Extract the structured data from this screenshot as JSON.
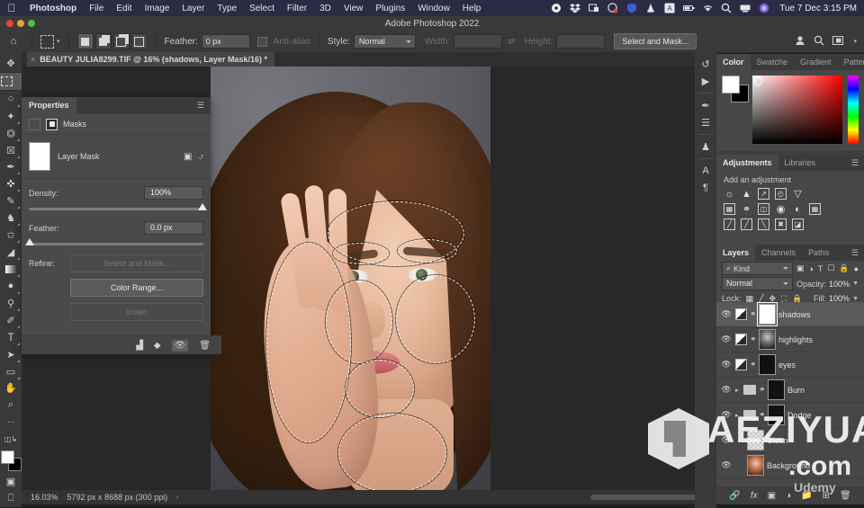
{
  "macmenu": {
    "apple": "apple-logo",
    "items": [
      "Photoshop",
      "File",
      "Edit",
      "Image",
      "Layer",
      "Type",
      "Select",
      "Filter",
      "3D",
      "View",
      "Plugins",
      "Window",
      "Help"
    ],
    "status_icons": [
      "record-icon",
      "dropbox-icon",
      "screenlock-icon",
      "camera-icon",
      "shield-icon",
      "vlc-icon",
      "character-a-icon",
      "battery-icon",
      "wifi-icon",
      "search-icon",
      "display-icon",
      "siri-icon"
    ],
    "clock": "Tue 7 Dec  3:15 PM"
  },
  "window": {
    "title": "Adobe Photoshop 2022"
  },
  "options": {
    "home_icon": "home-icon",
    "tool_icon": "rectangular-marquee-icon",
    "tool_caret": "▾",
    "selection_modes": [
      "new-selection",
      "add-to-selection",
      "subtract-from-selection",
      "intersect-selection"
    ],
    "feather_label": "Feather:",
    "feather_value": "0 px",
    "antialias_label": "Anti-alias",
    "style_label": "Style:",
    "style_value": "Normal",
    "width_label": "Width:",
    "width_value": "",
    "swap_icon": "swap-dimensions-icon",
    "height_label": "Height:",
    "height_value": "",
    "select_and_mask": "Select and Mask...",
    "right_icons": [
      "workspace-user-icon",
      "search-icon",
      "arrange-documents-icon"
    ],
    "right_caret": "▾"
  },
  "tab": {
    "close": "×",
    "title": "BEAUTY JULIA8299.TIF @ 16% (shadows, Layer Mask/16) *"
  },
  "toolbar": {
    "tools": [
      {
        "name": "move-tool",
        "glyph": "✥"
      },
      {
        "name": "rectangular-marquee-tool",
        "glyph": "⬚"
      },
      {
        "name": "lasso-tool",
        "glyph": "⟳"
      },
      {
        "name": "object-selection-tool",
        "glyph": "❦"
      },
      {
        "name": "crop-tool",
        "glyph": "⚔"
      },
      {
        "name": "frame-tool",
        "glyph": "⌧"
      },
      {
        "name": "eyedropper-tool",
        "glyph": "✐"
      },
      {
        "name": "spot-healing-brush-tool",
        "glyph": "✒"
      },
      {
        "name": "brush-tool",
        "glyph": "✎"
      },
      {
        "name": "clone-stamp-tool",
        "glyph": "♟"
      },
      {
        "name": "history-brush-tool",
        "glyph": "☙"
      },
      {
        "name": "eraser-tool",
        "glyph": "◢"
      },
      {
        "name": "gradient-tool",
        "glyph": "▣"
      },
      {
        "name": "blur-tool",
        "glyph": "●"
      },
      {
        "name": "dodge-tool",
        "glyph": "⚲"
      },
      {
        "name": "pen-tool",
        "glyph": "✒"
      },
      {
        "name": "type-tool",
        "glyph": "T"
      },
      {
        "name": "path-selection-tool",
        "glyph": "➤"
      },
      {
        "name": "rectangle-tool",
        "glyph": "▭"
      },
      {
        "name": "hand-tool",
        "glyph": "✋"
      },
      {
        "name": "zoom-tool",
        "glyph": "⌕"
      },
      {
        "name": "edit-toolbar-tool",
        "glyph": "•••"
      },
      {
        "name": "default-colors-tool",
        "glyph": "◧"
      }
    ],
    "foreground_color": "#ffffff",
    "background_color": "#000000",
    "quickmask_icon": "quick-mask-icon",
    "screenmode_icon": "screen-mode-icon"
  },
  "vdock": {
    "icons": [
      "history-icon",
      "actions-play-icon",
      "brush-settings-icon",
      "properties-sliders-icon",
      "clone-source-icon",
      "character-icon",
      "paragraph-icon"
    ]
  },
  "properties": {
    "tab": "Properties",
    "menu_icon": "panel-menu-icon",
    "masks_tabs": [
      "pixel-mask-icon",
      "vector-mask-icon"
    ],
    "masks_label": "Masks",
    "layer_mask_label": "Layer Mask",
    "mask_icons": [
      "select-mask-icon",
      "mask-options-icon"
    ],
    "density_label": "Density:",
    "density_value": "100%",
    "density_percent": 100,
    "feather_label": "Feather:",
    "feather_value": "0.0 px",
    "feather_percent": 0,
    "refine_label": "Refine:",
    "buttons": [
      {
        "label": "Select and Mask...",
        "enabled": false
      },
      {
        "label": "Color Range...",
        "enabled": true
      },
      {
        "label": "Invert",
        "enabled": false
      }
    ],
    "footer_icons": [
      "load-selection-icon",
      "apply-mask-icon",
      "toggle-mask-icon",
      "delete-mask-icon"
    ]
  },
  "canvas": {
    "background": "#282828",
    "zoom": "16.03%",
    "dimensions": "5792 px x 8688 px (300 ppi)",
    "caret": "›"
  },
  "color_panel": {
    "tabs": [
      "Color",
      "Swatche",
      "Gradient",
      "Patterns"
    ],
    "active_tab": "Color",
    "menu_icon": "panel-menu-icon",
    "foreground": "#ffffff",
    "background": "#000000"
  },
  "adjustments": {
    "tabs": [
      "Adjustments",
      "Libraries"
    ],
    "active_tab": "Adjustments",
    "menu_icon": "panel-menu-icon",
    "title": "Add an adjustment",
    "rows": [
      [
        "brightness-contrast-icon",
        "levels-icon",
        "curves-icon",
        "exposure-icon",
        "vibrance-icon"
      ],
      [
        "hue-saturation-icon",
        "color-balance-icon",
        "black-white-icon",
        "photo-filter-icon",
        "channel-mixer-icon",
        "color-lookup-icon"
      ],
      [
        "invert-icon",
        "posterize-icon",
        "threshold-icon",
        "selective-color-icon",
        "gradient-map-icon"
      ]
    ]
  },
  "layers_panel": {
    "tabs": [
      "Layers",
      "Channels",
      "Paths"
    ],
    "active_tab": "Layers",
    "menu_icon": "panel-menu-icon",
    "filter_label": "Kind",
    "filter_search_icon": "search-icon",
    "filter_icons": [
      "filter-pixel-icon",
      "filter-adjustment-icon",
      "filter-type-icon",
      "filter-shape-icon",
      "filter-smart-icon"
    ],
    "filter_toggle": "filter-toggle-icon",
    "blend_mode": "Normal",
    "opacity_label": "Opacity:",
    "opacity_value": "100%",
    "lock_label": "Lock:",
    "lock_icons": [
      "lock-transparent-icon",
      "lock-image-icon",
      "lock-position-icon",
      "lock-artboard-icon",
      "lock-all-icon"
    ],
    "fill_label": "Fill:",
    "fill_value": "100%",
    "layers": [
      {
        "name": "shadows",
        "visible": true,
        "type": "adjustment",
        "thumb": "white",
        "selected": true,
        "linked": true
      },
      {
        "name": "highlights",
        "visible": true,
        "type": "adjustment",
        "thumb": "portrait",
        "selected": false,
        "linked": true
      },
      {
        "name": "eyes",
        "visible": true,
        "type": "adjustment",
        "thumb": "black",
        "selected": false,
        "linked": true
      },
      {
        "name": "Burn",
        "visible": true,
        "type": "group",
        "thumb": "dark",
        "selected": false,
        "linked": true
      },
      {
        "name": "Dodge",
        "visible": true,
        "type": "group",
        "thumb": "dark",
        "selected": false,
        "linked": true
      },
      {
        "name": "Clean",
        "visible": true,
        "type": "pixel",
        "thumb": "clean",
        "selected": false,
        "linked": false
      },
      {
        "name": "Background",
        "visible": true,
        "type": "pixel",
        "thumb": "portrait",
        "selected": false,
        "linked": false
      }
    ],
    "footer_icons": [
      "link-layers-icon",
      "layer-style-fx-icon",
      "add-mask-icon",
      "new-fill-adjustment-icon",
      "new-group-icon",
      "new-layer-icon",
      "delete-layer-icon"
    ]
  },
  "watermark": {
    "logo": "aeziyuan-logo",
    "text": "AEZIYUAN",
    "sub": ".com",
    "udemy": "Udemy"
  }
}
